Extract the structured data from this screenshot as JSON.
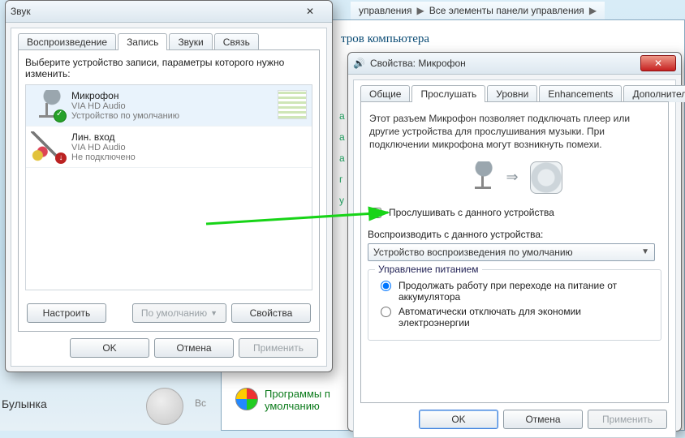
{
  "breadcrumb": {
    "a": "управления",
    "b": "Все элементы панели управления"
  },
  "bg": {
    "heading": "тров компьютера",
    "bulynka": "Булынка",
    "bce": "Вс",
    "prog_line1": "Программы п",
    "prog_line2": "умолчанию",
    "side_items": [
      "а",
      "а",
      "а",
      "г",
      "у"
    ]
  },
  "sound": {
    "title": "Звук",
    "tabs": [
      "Воспроизведение",
      "Запись",
      "Звуки",
      "Связь"
    ],
    "active_tab": 1,
    "hint": "Выберите устройство записи, параметры которого нужно изменить:",
    "devices": [
      {
        "name": "Микрофон",
        "driver": "VIA HD Audio",
        "status": "Устройство по умолчанию",
        "selected": true,
        "level": true,
        "icon": "mic",
        "ok": true
      },
      {
        "name": "Лин. вход",
        "driver": "VIA HD Audio",
        "status": "Не подключено",
        "selected": false,
        "level": false,
        "icon": "line",
        "down": true
      }
    ],
    "btn_configure": "Настроить",
    "btn_default": "По умолчанию",
    "btn_props": "Свойства",
    "btn_ok": "OK",
    "btn_cancel": "Отмена",
    "btn_apply": "Применить"
  },
  "props": {
    "title": "Свойства: Микрофон",
    "tabs": [
      "Общие",
      "Прослушать",
      "Уровни",
      "Enhancements",
      "Дополнительно"
    ],
    "active_tab": 1,
    "note": "Этот разъем Микрофон позволяет подключать плеер или другие устройства для прослушивания музыки. При подключении микрофона могут возникнуть помехи.",
    "listen_label": "Прослушивать с данного устройства",
    "listen_checked": false,
    "playthru_label": "Воспроизводить с данного устройства:",
    "playthru_value": "Устройство воспроизведения по умолчанию",
    "power_group": "Управление питанием",
    "power_opt1": "Продолжать работу при переходе на питание от аккумулятора",
    "power_opt2": "Автоматически отключать для экономии электроэнергии",
    "power_selected": 0,
    "btn_ok": "OK",
    "btn_cancel": "Отмена",
    "btn_apply": "Применить"
  }
}
